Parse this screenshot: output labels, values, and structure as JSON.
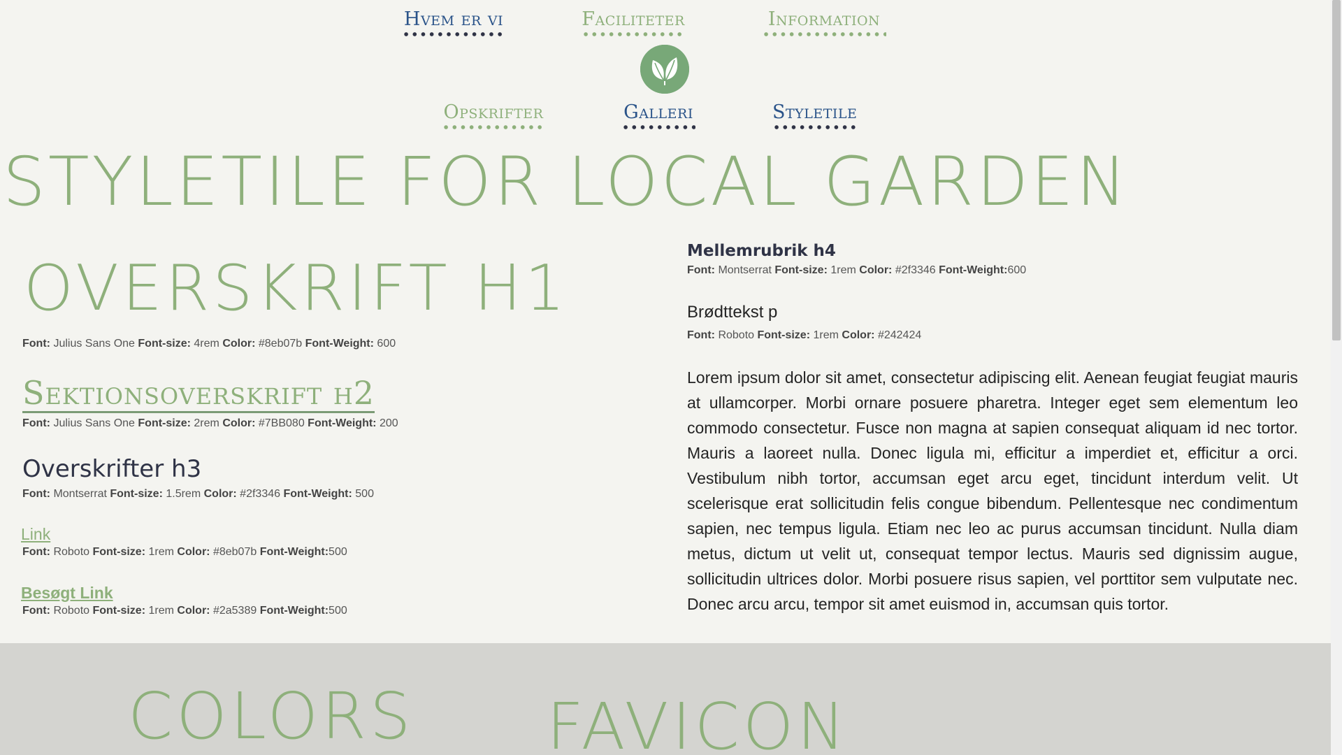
{
  "nav": {
    "items": [
      {
        "label": "Hvem er vi"
      },
      {
        "label": "Faciliteter"
      },
      {
        "label": "Information"
      },
      {
        "label": "Opskrifter"
      },
      {
        "label": "Galleri"
      },
      {
        "label": "Styletile"
      }
    ],
    "logo_icon": "leaf-icon"
  },
  "page_title": "STYLETILE FOR LOCAL GARDEN",
  "typography": {
    "h1": {
      "sample": "OVERSKRIFT H1",
      "spec": {
        "font_label": "Font:",
        "font": "Julius Sans One",
        "size_label": "Font-size:",
        "size": "4rem",
        "color_label": "Color:",
        "color": "#8eb07b",
        "weight_label": "Font-Weight:",
        "weight": "600"
      }
    },
    "h2": {
      "sample": "Sektionsoverskrift h2",
      "spec": {
        "font_label": "Font:",
        "font": "Julius Sans One",
        "size_label": "Font-size:",
        "size": "2rem",
        "color_label": "Color:",
        "color": "#7BB080",
        "weight_label": "Font-Weight:",
        "weight": "200"
      }
    },
    "h3": {
      "sample": "Overskrifter h3",
      "spec": {
        "font_label": "Font:",
        "font": "Montserrat",
        "size_label": "Font-size:",
        "size": "1.5rem",
        "color_label": "Color:",
        "color": "#2f3346",
        "weight_label": "Font-Weight:",
        "weight": "500"
      }
    },
    "link": {
      "sample": "Link",
      "spec": {
        "font_label": "Font:",
        "font": "Roboto",
        "size_label": "Font-size:",
        "size": "1rem",
        "color_label": "Color:",
        "color": "#8eb07b",
        "weight_label": "Font-Weight:",
        "weight": "500"
      }
    },
    "visited_link": {
      "sample": "Besøgt Link",
      "spec": {
        "font_label": "Font:",
        "font": "Roboto",
        "size_label": "Font-size:",
        "size": "1rem",
        "color_label": "Color:",
        "color": "#2a5389",
        "weight_label": "Font-Weight:",
        "weight": "500"
      }
    },
    "h4": {
      "sample": "Mellemrubrik h4",
      "spec": {
        "font_label": "Font:",
        "font": "Montserrat",
        "size_label": "Font-size:",
        "size": "1rem",
        "color_label": "Color:",
        "color": "#2f3346",
        "weight_label": "Font-Weight:",
        "weight": "600"
      }
    },
    "p": {
      "sample": "Brødttekst p",
      "spec": {
        "font_label": "Font:",
        "font": "Roboto",
        "size_label": "Font-size:",
        "size": "1rem",
        "color_label": "Color:",
        "color": "#242424"
      }
    }
  },
  "lorem": "Lorem ipsum dolor sit amet, consectetur adipiscing elit. Aenean feugiat feugiat mauris at ullamcorper. Morbi ornare posuere pharetra. Integer eget sem elementum leo commodo consectetur. Fusce non magna at sapien consequat aliquam id nec tortor. Mauris a laoreet nulla. Donec ligula mi, efficitur a imperdiet et, efficitur a orci. Vestibulum nibh tortor, accumsan eget arcu eget, tincidunt interdum velit. Ut scelerisque erat sollicitudin felis congue bibendum. Pellentesque nec condimentum sapien, nec tempus ligula. Etiam nec leo ac purus accumsan tincidunt. Nulla diam metus, dictum ut velit ut, consequat tempor lectus. Mauris sed dignissim augue, sollicitudin ultrices dolor. Morbi posuere risus sapien, vel porttitor sem vulputate nec. Donec arcu arcu, tempor sit amet euismod in, accumsan quis tortor.",
  "band": {
    "colors_title": "COLORS",
    "favicon_title": "FAVICON"
  },
  "colors": {
    "green": "#8eb07b",
    "blue": "#2a5389",
    "dark": "#2f3346",
    "text": "#242424",
    "background": "#f4f4f0",
    "band": "#d4d4d0"
  }
}
